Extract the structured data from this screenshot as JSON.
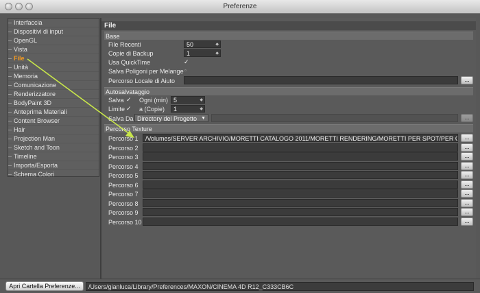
{
  "window": {
    "title": "Preferenze"
  },
  "sidebar": {
    "items": [
      {
        "label": "Interfaccia"
      },
      {
        "label": "Dispositivi di input"
      },
      {
        "label": "OpenGL"
      },
      {
        "label": "Vista"
      },
      {
        "label": "File",
        "active": true
      },
      {
        "label": "Unità"
      },
      {
        "label": "Memoria"
      },
      {
        "label": "Comunicazione"
      },
      {
        "label": "Renderizzatore"
      },
      {
        "label": "BodyPaint 3D"
      },
      {
        "label": "Anteprima Materiali"
      },
      {
        "label": "Content Browser"
      },
      {
        "label": "Hair"
      },
      {
        "label": "Projection Man"
      },
      {
        "label": "Sketch and Toon"
      },
      {
        "label": "Timeline"
      },
      {
        "label": "Importa/Esporta"
      },
      {
        "label": "Schema Colori"
      }
    ]
  },
  "panel": {
    "title": "File",
    "base": {
      "header": "Base",
      "recent_label": "File Recenti",
      "recent_value": "50",
      "backup_label": "Copie di Backup",
      "backup_value": "1",
      "quicktime_label": "Usa QuickTime",
      "quicktime_checked": "✓",
      "melange_label": "Salva Poligoni per Melange",
      "melange_checked": "▫",
      "help_label": "Percorso Locale di Aiuto",
      "help_value": ""
    },
    "autosave": {
      "header": "Autosalvataggio",
      "save_label": "Salva",
      "save_checked": "✓",
      "every_label": "Ogni (min)",
      "every_value": "5",
      "limit_label": "Limite",
      "limit_checked": "✓",
      "copies_label": "a (Copie)",
      "copies_value": "1",
      "from_label": "Salva Da",
      "from_value": "Directory del Progetto"
    },
    "texture": {
      "header": "Percorso Texture",
      "paths": [
        {
          "label": "Percorso 1",
          "value": "/Volumes/SERVER ARCHIVIO/MORETTI CATALOGO 2011/MORETTI RENDERING/MORETTI PER SPOT/PER CI"
        },
        {
          "label": "Percorso 2",
          "value": ""
        },
        {
          "label": "Percorso 3",
          "value": ""
        },
        {
          "label": "Percorso 4",
          "value": ""
        },
        {
          "label": "Percorso 5",
          "value": ""
        },
        {
          "label": "Percorso 6",
          "value": ""
        },
        {
          "label": "Percorso 7",
          "value": ""
        },
        {
          "label": "Percorso 8",
          "value": ""
        },
        {
          "label": "Percorso 9",
          "value": ""
        },
        {
          "label": "Percorso 10",
          "value": ""
        }
      ]
    },
    "browse_label": "..."
  },
  "footer": {
    "open_button": "Apri Cartella Preferenze...",
    "path": "/Users/gianluca/Library/Preferences/MAXON/CINEMA 4D R12_C333CB6C"
  },
  "colors": {
    "active_item": "#f29a22",
    "annotation_arrow": "#c8e64a"
  }
}
